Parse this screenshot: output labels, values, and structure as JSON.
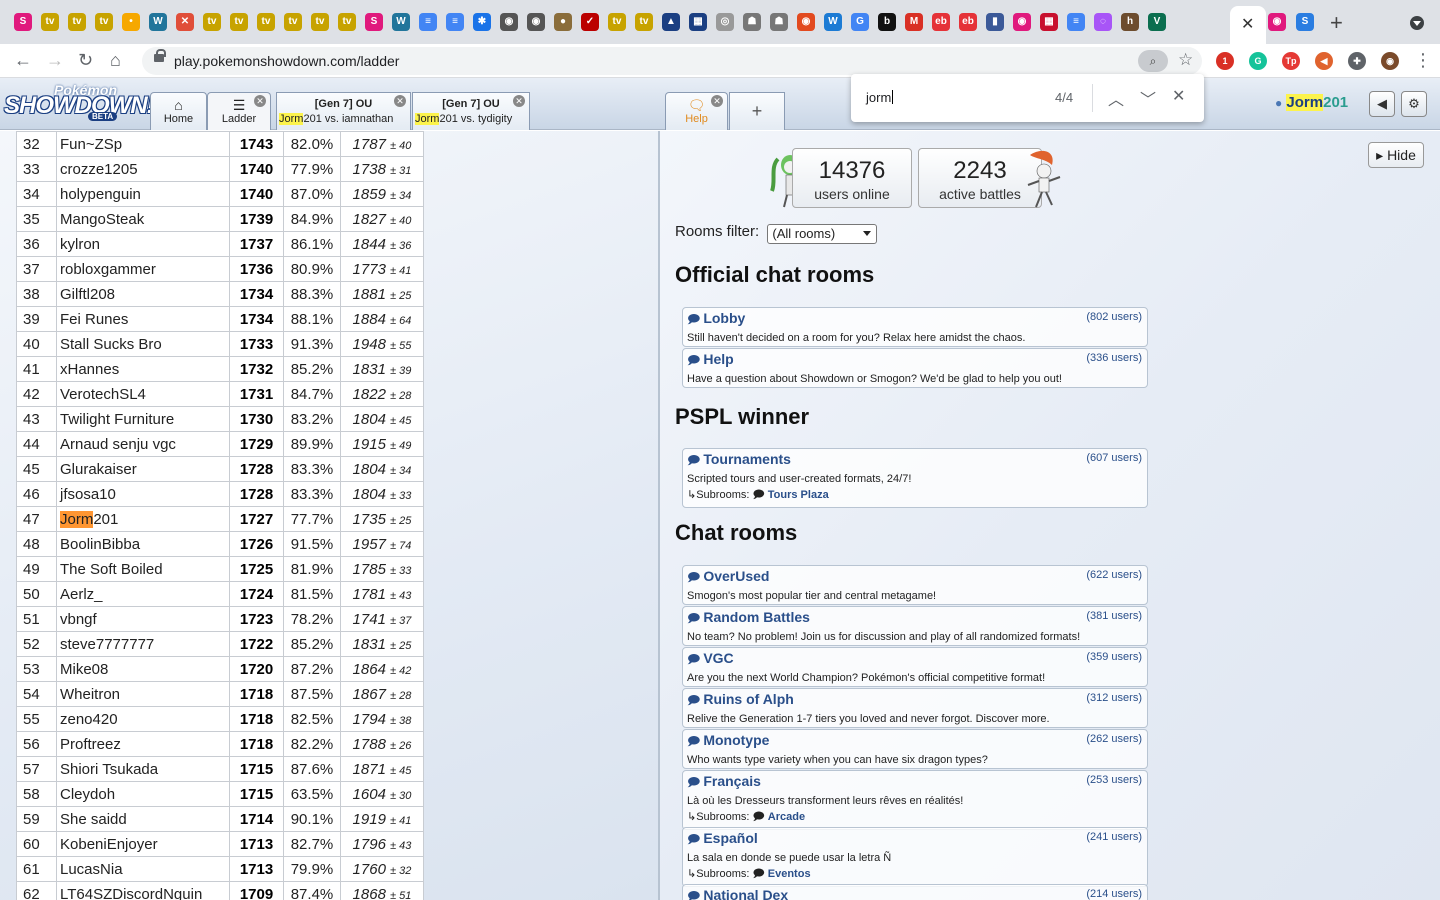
{
  "browser": {
    "url": "play.pokemonshowdown.com/ladder",
    "active_tab_close": "✕",
    "tab_icons": [
      {
        "label": "S",
        "color": "#e0197d"
      },
      {
        "label": "tv",
        "color": "#c7a300"
      },
      {
        "label": "tv",
        "color": "#c7a300"
      },
      {
        "label": "tv",
        "color": "#c7a300"
      },
      {
        "label": "•",
        "color": "#f6a800"
      },
      {
        "label": "W",
        "color": "#21759b"
      },
      {
        "label": "✕",
        "color": "#e04e39"
      },
      {
        "label": "tv",
        "color": "#c7a300"
      },
      {
        "label": "tv",
        "color": "#c7a300"
      },
      {
        "label": "tv",
        "color": "#c7a300"
      },
      {
        "label": "tv",
        "color": "#c7a300"
      },
      {
        "label": "tv",
        "color": "#c7a300"
      },
      {
        "label": "tv",
        "color": "#c7a300"
      },
      {
        "label": "S",
        "color": "#e0197d"
      },
      {
        "label": "W",
        "color": "#21759b"
      },
      {
        "label": "≡",
        "color": "#4285f4"
      },
      {
        "label": "≡",
        "color": "#4285f4"
      },
      {
        "label": "✱",
        "color": "#1a73e8"
      },
      {
        "label": "◉",
        "color": "#555"
      },
      {
        "label": "◉",
        "color": "#555"
      },
      {
        "label": "●",
        "color": "#8a6d3b"
      },
      {
        "label": "✓",
        "color": "#b00"
      },
      {
        "label": "tv",
        "color": "#c7a300"
      },
      {
        "label": "tv",
        "color": "#c7a300"
      },
      {
        "label": "▲",
        "color": "#1b3f82"
      },
      {
        "label": "▦",
        "color": "#1b3f82"
      },
      {
        "label": "◎",
        "color": "#999"
      },
      {
        "label": "☗",
        "color": "#777"
      },
      {
        "label": "☗",
        "color": "#777"
      },
      {
        "label": "◉",
        "color": "#e24a1f"
      },
      {
        "label": "W",
        "color": "#1c7bd4"
      },
      {
        "label": "G",
        "color": "#4285f4"
      },
      {
        "label": "b",
        "color": "#111"
      },
      {
        "label": "M",
        "color": "#d93025"
      },
      {
        "label": "eb",
        "color": "#e53238"
      },
      {
        "label": "eb",
        "color": "#e53238"
      },
      {
        "label": "▮",
        "color": "#3b5998"
      },
      {
        "label": "◉",
        "color": "#e0197d"
      },
      {
        "label": "▦",
        "color": "#c8102e"
      },
      {
        "label": "≡",
        "color": "#4285f4"
      },
      {
        "label": "◌",
        "color": "#a855f7"
      },
      {
        "label": "h",
        "color": "#6d4c2e"
      },
      {
        "label": "V",
        "color": "#0b6e4f"
      }
    ],
    "right_tab_icons": [
      {
        "label": "◉",
        "color": "#e0197d"
      },
      {
        "label": "S",
        "color": "#2a7de1"
      }
    ],
    "extensions": [
      {
        "label": "1",
        "color": "#d93025"
      },
      {
        "label": "G",
        "color": "#15c39a"
      },
      {
        "label": "Tp",
        "color": "#e53935"
      },
      {
        "label": "◀",
        "color": "#e0632e"
      },
      {
        "label": "✚",
        "color": "#5f6368"
      },
      {
        "label": "◉",
        "color": "#7a4a2a"
      }
    ]
  },
  "ps_header": {
    "logo_top": "Pokémon",
    "logo_main": "SHOWDOWN!",
    "logo_badge": "BETA",
    "tabs": [
      {
        "icon": "⌂",
        "label": "Home"
      },
      {
        "icon": "☰",
        "label": "Ladder"
      }
    ],
    "battle_tabs": [
      {
        "title": "[Gen 7] OU",
        "player": "Jorm",
        "rest": "201 vs. iamnathan"
      },
      {
        "title": "[Gen 7] OU",
        "player": "Jorm",
        "rest": "201 vs. tydigity"
      }
    ],
    "help_tab": {
      "icon": "🗨",
      "label": "Help"
    },
    "new_tab": "+",
    "user": {
      "prefix": "Jorm",
      "suffix": "201"
    },
    "sound_icon": "◀",
    "settings_icon": "⚙"
  },
  "find_bar": {
    "query": "jorm",
    "count": "4/4",
    "prev": "︿",
    "next": "﹀",
    "close": "✕"
  },
  "ladder": {
    "rows": [
      {
        "rank": "32",
        "name": "Fun~ZSp",
        "elo": "1743",
        "gxe": "82.0%",
        "glicko": "1787",
        "dev": "± 40"
      },
      {
        "rank": "33",
        "name": "crozze1205",
        "elo": "1740",
        "gxe": "77.9%",
        "glicko": "1738",
        "dev": "± 31"
      },
      {
        "rank": "34",
        "name": "holypenguin",
        "elo": "1740",
        "gxe": "87.0%",
        "glicko": "1859",
        "dev": "± 34"
      },
      {
        "rank": "35",
        "name": "MangoSteak",
        "elo": "1739",
        "gxe": "84.9%",
        "glicko": "1827",
        "dev": "± 40"
      },
      {
        "rank": "36",
        "name": "kylron",
        "elo": "1737",
        "gxe": "86.1%",
        "glicko": "1844",
        "dev": "± 36"
      },
      {
        "rank": "37",
        "name": "robloxgammer",
        "elo": "1736",
        "gxe": "80.9%",
        "glicko": "1773",
        "dev": "± 41"
      },
      {
        "rank": "38",
        "name": "Gilftl208",
        "elo": "1734",
        "gxe": "88.3%",
        "glicko": "1881",
        "dev": "± 25"
      },
      {
        "rank": "39",
        "name": "Fei Runes",
        "elo": "1734",
        "gxe": "88.1%",
        "glicko": "1884",
        "dev": "± 64"
      },
      {
        "rank": "40",
        "name": "Stall Sucks Bro",
        "elo": "1733",
        "gxe": "91.3%",
        "glicko": "1948",
        "dev": "± 55"
      },
      {
        "rank": "41",
        "name": "xHannes",
        "elo": "1732",
        "gxe": "85.2%",
        "glicko": "1831",
        "dev": "± 39"
      },
      {
        "rank": "42",
        "name": "VerotechSL4",
        "elo": "1731",
        "gxe": "84.7%",
        "glicko": "1822",
        "dev": "± 28"
      },
      {
        "rank": "43",
        "name": "Twilight Furniture",
        "elo": "1730",
        "gxe": "83.2%",
        "glicko": "1804",
        "dev": "± 45"
      },
      {
        "rank": "44",
        "name": "Arnaud senju vgc",
        "elo": "1729",
        "gxe": "89.9%",
        "glicko": "1915",
        "dev": "± 49"
      },
      {
        "rank": "45",
        "name": "Glurakaiser",
        "elo": "1728",
        "gxe": "83.3%",
        "glicko": "1804",
        "dev": "± 34"
      },
      {
        "rank": "46",
        "name": "jfsosa10",
        "elo": "1728",
        "gxe": "83.3%",
        "glicko": "1804",
        "dev": "± 33"
      },
      {
        "rank": "47",
        "name": "Jorm201",
        "name_hl": "Jorm",
        "name_rest": "201",
        "elo": "1727",
        "gxe": "77.7%",
        "glicko": "1735",
        "dev": "± 25"
      },
      {
        "rank": "48",
        "name": "BoolinBibba",
        "elo": "1726",
        "gxe": "91.5%",
        "glicko": "1957",
        "dev": "± 74"
      },
      {
        "rank": "49",
        "name": "The Soft Boiled",
        "elo": "1725",
        "gxe": "81.9%",
        "glicko": "1785",
        "dev": "± 33"
      },
      {
        "rank": "50",
        "name": "Aerlz_",
        "elo": "1724",
        "gxe": "81.5%",
        "glicko": "1781",
        "dev": "± 43"
      },
      {
        "rank": "51",
        "name": "vbngf",
        "elo": "1723",
        "gxe": "78.2%",
        "glicko": "1741",
        "dev": "± 37"
      },
      {
        "rank": "52",
        "name": "steve7777777",
        "elo": "1722",
        "gxe": "85.2%",
        "glicko": "1831",
        "dev": "± 25"
      },
      {
        "rank": "53",
        "name": "Mike08",
        "elo": "1720",
        "gxe": "87.2%",
        "glicko": "1864",
        "dev": "± 42"
      },
      {
        "rank": "54",
        "name": "Wheitron",
        "elo": "1718",
        "gxe": "87.5%",
        "glicko": "1867",
        "dev": "± 28"
      },
      {
        "rank": "55",
        "name": "zeno420",
        "elo": "1718",
        "gxe": "82.5%",
        "glicko": "1794",
        "dev": "± 38"
      },
      {
        "rank": "56",
        "name": "Proftreez",
        "elo": "1718",
        "gxe": "82.2%",
        "glicko": "1788",
        "dev": "± 26"
      },
      {
        "rank": "57",
        "name": "Shiori Tsukada",
        "elo": "1715",
        "gxe": "87.6%",
        "glicko": "1871",
        "dev": "± 45"
      },
      {
        "rank": "58",
        "name": "Cleydoh",
        "elo": "1715",
        "gxe": "63.5%",
        "glicko": "1604",
        "dev": "± 30"
      },
      {
        "rank": "59",
        "name": "She saidd",
        "elo": "1714",
        "gxe": "90.1%",
        "glicko": "1919",
        "dev": "± 41"
      },
      {
        "rank": "60",
        "name": "KobeniEnjoyer",
        "elo": "1713",
        "gxe": "82.7%",
        "glicko": "1796",
        "dev": "± 43"
      },
      {
        "rank": "61",
        "name": "LucasNia",
        "elo": "1713",
        "gxe": "79.9%",
        "glicko": "1760",
        "dev": "± 32"
      },
      {
        "rank": "62",
        "name": "LT64SZDiscordNguin",
        "elo": "1709",
        "gxe": "87.4%",
        "glicko": "1868",
        "dev": "± 51"
      }
    ]
  },
  "rooms_panel": {
    "hide_label": "Hide",
    "users_online": "14376",
    "users_online_label": "users online",
    "active_battles": "2243",
    "active_battles_label": "active battles",
    "filter_label": "Rooms filter:",
    "filter_value": "(All rooms)",
    "sections": [
      {
        "title": "Official chat rooms",
        "rooms": [
          {
            "name": "Lobby",
            "users": "(802 users)",
            "desc": "Still haven't decided on a room for you? Relax here amidst the chaos."
          },
          {
            "name": "Help",
            "users": "(336 users)",
            "desc": "Have a question about Showdown or Smogon? We'd be glad to help you out!"
          }
        ]
      },
      {
        "title": "PSPL winner",
        "rooms": [
          {
            "name": "Tournaments",
            "users": "(607 users)",
            "desc": "Scripted tours and user-created formats, 24/7!",
            "sub_label": "↳Subrooms:",
            "sub": "Tours Plaza"
          }
        ]
      },
      {
        "title": "Chat rooms",
        "rooms": [
          {
            "name": "OverUsed",
            "users": "(622 users)",
            "desc": "Smogon's most popular tier and central metagame!"
          },
          {
            "name": "Random Battles",
            "users": "(381 users)",
            "desc": "No team? No problem! Join us for discussion and play of all randomized formats!"
          },
          {
            "name": "VGC",
            "users": "(359 users)",
            "desc": "Are you the next World Champion? Pokémon's official competitive format!"
          },
          {
            "name": "Ruins of Alph",
            "users": "(312 users)",
            "desc": "Relive the Generation 1-7 tiers you loved and never forgot. Discover more."
          },
          {
            "name": "Monotype",
            "users": "(262 users)",
            "desc": "Who wants type variety when you can have six dragon types?"
          },
          {
            "name": "Français",
            "users": "(253 users)",
            "desc": "Là où les Dresseurs transforment leurs rêves en réalités!",
            "sub_label": "↳Subrooms:",
            "sub": "Arcade"
          },
          {
            "name": "Español",
            "users": "(241 users)",
            "desc": "La sala en donde se puede usar la letra Ñ",
            "sub_label": "↳Subrooms:",
            "sub": "Eventos"
          },
          {
            "name": "National Dex",
            "users": "(214 users)",
            "desc": ""
          }
        ]
      }
    ]
  }
}
